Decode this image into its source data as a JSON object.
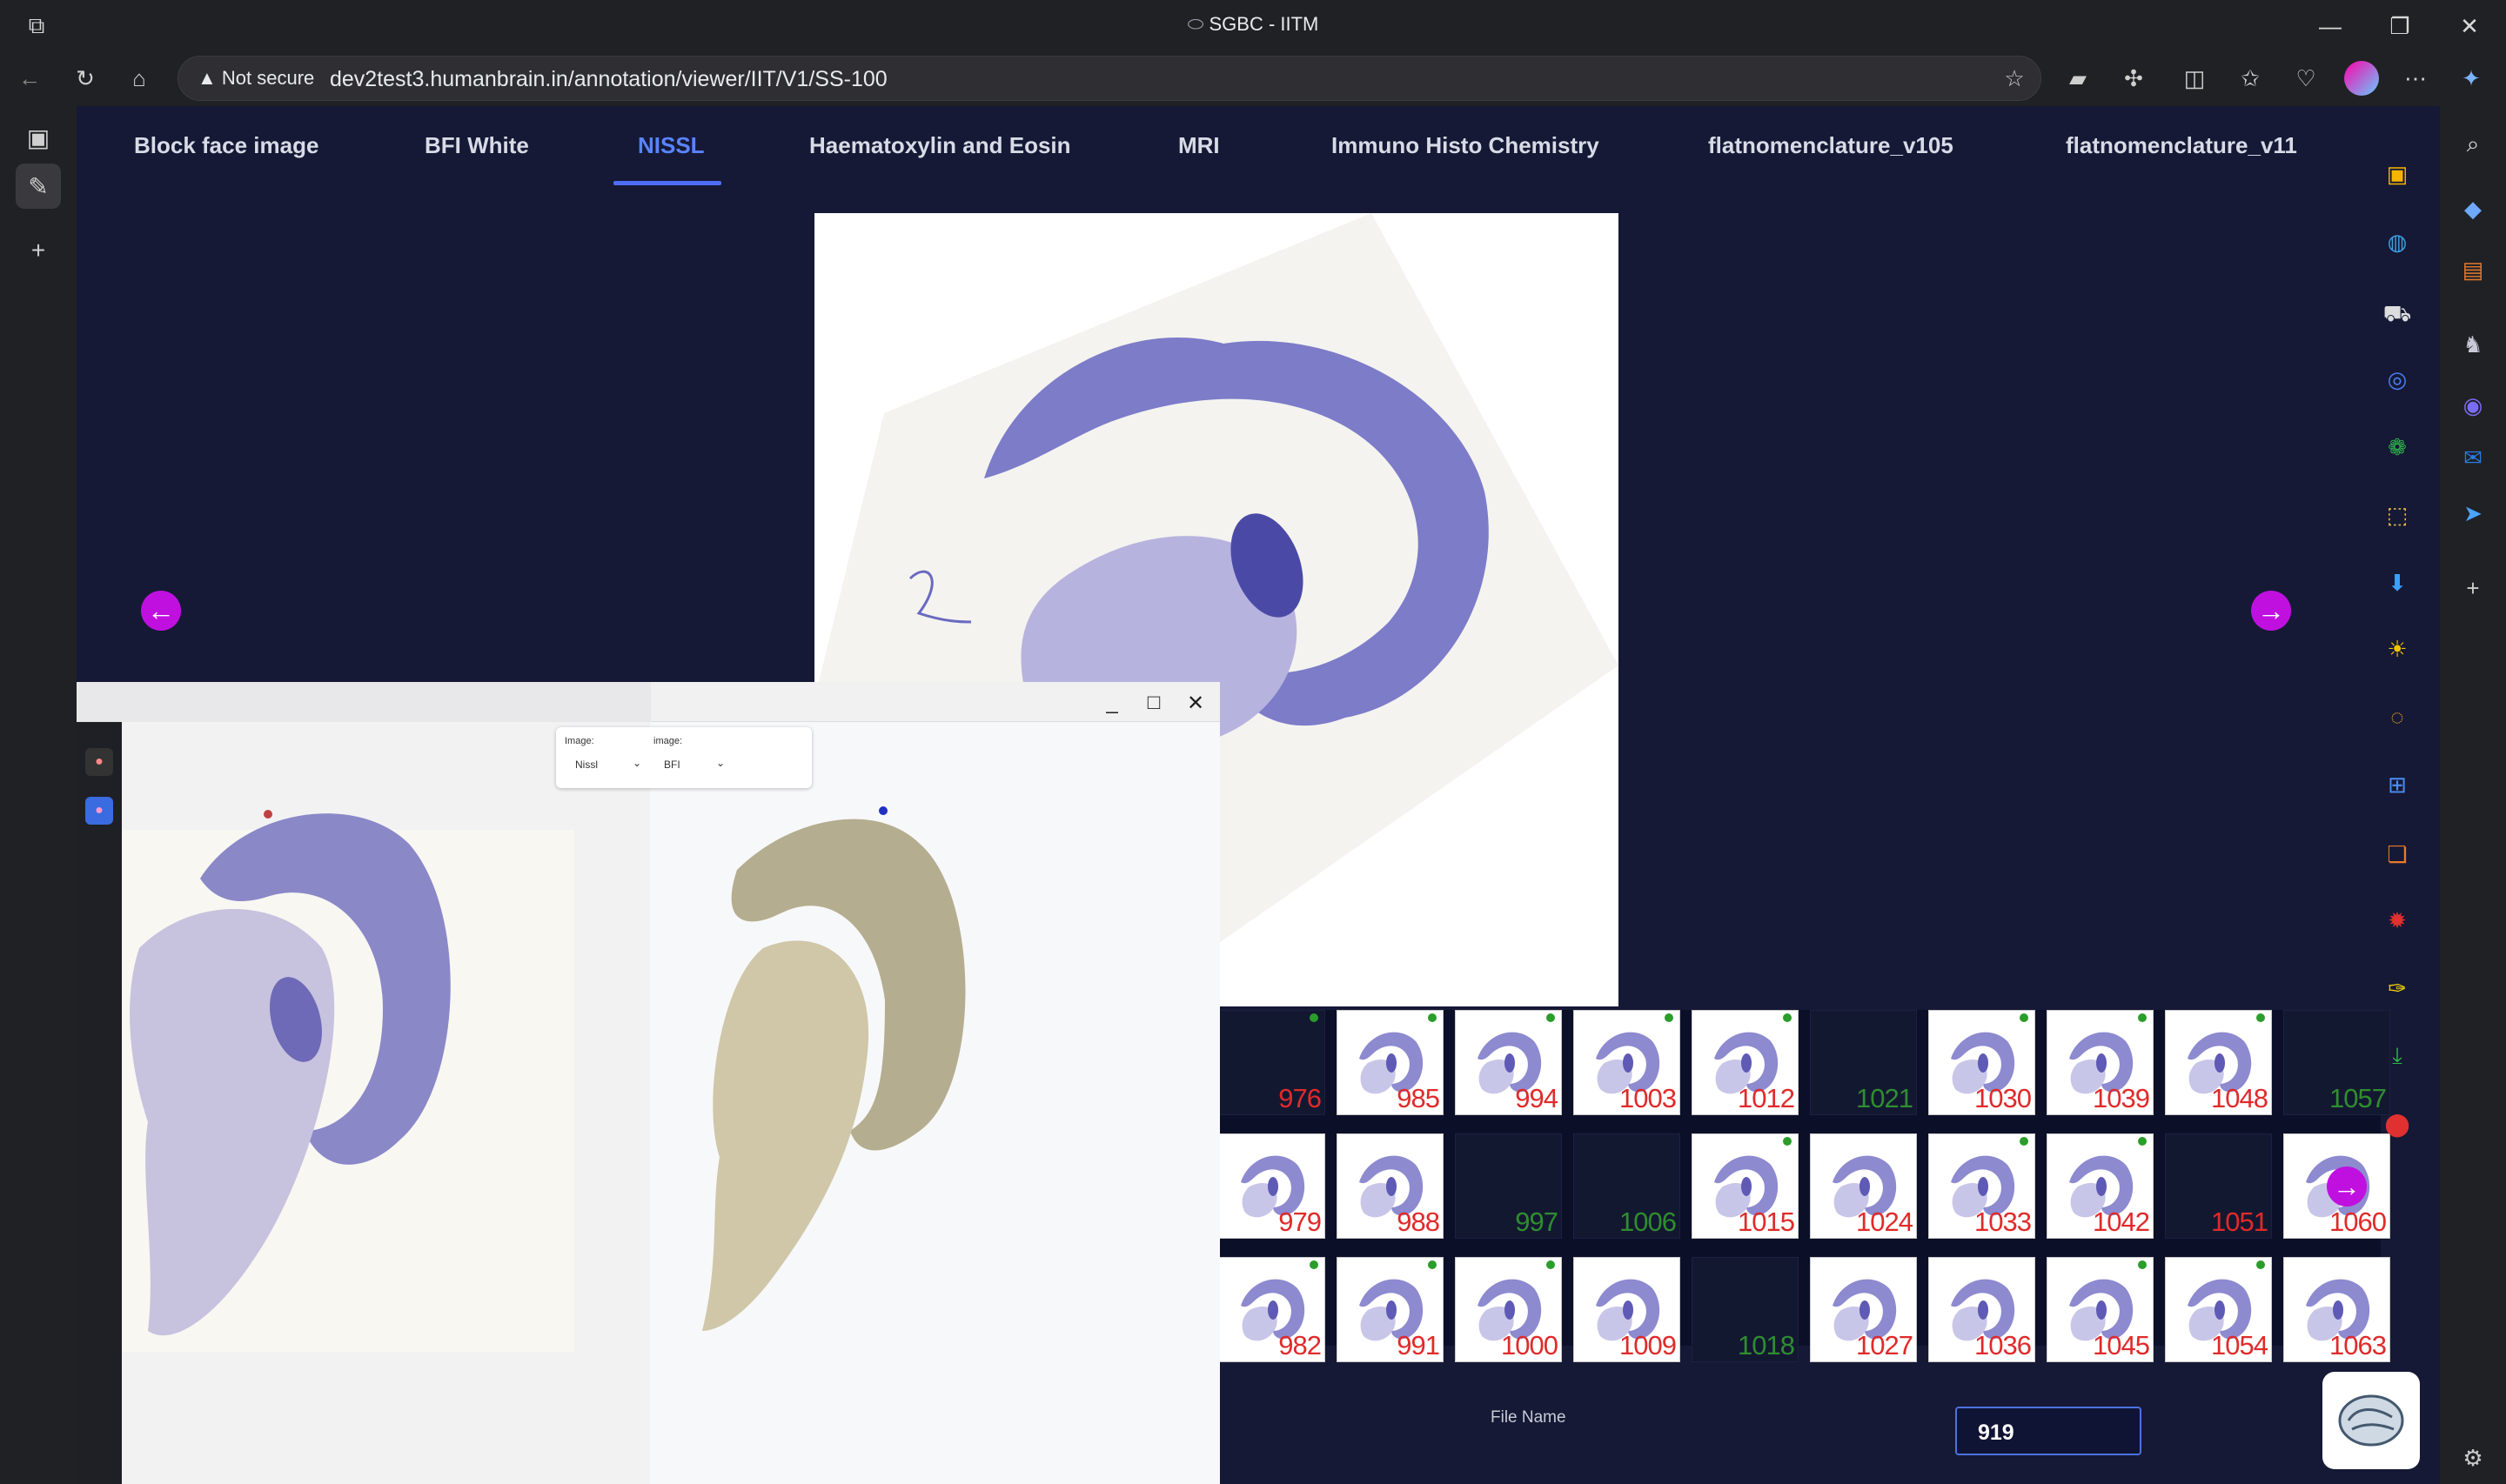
{
  "browser": {
    "window_title": "SGBC - IITM",
    "security_label": "Not secure",
    "url": "dev2test3.humanbrain.in/annotation/viewer/IIT/V1/SS-100"
  },
  "tabs": [
    {
      "label": "Block face image"
    },
    {
      "label": "BFI White"
    },
    {
      "label": "NISSL",
      "active": true
    },
    {
      "label": "Haematoxylin and Eosin"
    },
    {
      "label": "MRI"
    },
    {
      "label": "Immuno Histo Chemistry"
    },
    {
      "label": "flatnomenclature_v105"
    },
    {
      "label": "flatnomenclature_v11"
    }
  ],
  "nav": {
    "prev_icon": "arrow-left-icon",
    "next_icon": "arrow-right-icon"
  },
  "thumbnails": {
    "rows": [
      [
        {
          "n": "976",
          "img": false,
          "dot": true
        },
        {
          "n": "985",
          "img": true,
          "dot": true
        },
        {
          "n": "994",
          "img": true,
          "dot": true
        },
        {
          "n": "1003",
          "img": true,
          "dot": true
        },
        {
          "n": "1012",
          "img": true,
          "dot": true
        },
        {
          "n": "1021",
          "img": false,
          "dot": false
        },
        {
          "n": "1030",
          "img": true,
          "dot": true
        },
        {
          "n": "1039",
          "img": true,
          "dot": true
        },
        {
          "n": "1048",
          "img": true,
          "dot": true
        },
        {
          "n": "1057",
          "img": false,
          "dot": false
        }
      ],
      [
        {
          "n": "979",
          "img": true,
          "dot": false
        },
        {
          "n": "988",
          "img": true,
          "dot": false
        },
        {
          "n": "997",
          "img": false,
          "dot": false
        },
        {
          "n": "1006",
          "img": false,
          "dot": false
        },
        {
          "n": "1015",
          "img": true,
          "dot": true
        },
        {
          "n": "1024",
          "img": true,
          "dot": false
        },
        {
          "n": "1033",
          "img": true,
          "dot": true
        },
        {
          "n": "1042",
          "img": true,
          "dot": true
        },
        {
          "n": "1051",
          "img": false,
          "dot": false,
          "red": true
        },
        {
          "n": "1060",
          "img": true,
          "dot": false
        }
      ],
      [
        {
          "n": "982",
          "img": true,
          "dot": true
        },
        {
          "n": "991",
          "img": true,
          "dot": true
        },
        {
          "n": "1000",
          "img": true,
          "dot": true
        },
        {
          "n": "1009",
          "img": true,
          "dot": false
        },
        {
          "n": "1018",
          "img": false,
          "dot": false
        },
        {
          "n": "1027",
          "img": true,
          "dot": false
        },
        {
          "n": "1036",
          "img": true,
          "dot": false
        },
        {
          "n": "1045",
          "img": true,
          "dot": true
        },
        {
          "n": "1054",
          "img": true,
          "dot": true
        },
        {
          "n": "1063",
          "img": true,
          "dot": false
        }
      ]
    ],
    "colors": {
      "red": "#e02a2a",
      "green": "#2f8d2f",
      "dot": "#2a9d2a"
    }
  },
  "footer": {
    "file_name_label": "File Name",
    "file_name_value": "919"
  },
  "popup": {
    "left_select": {
      "label": "Image:",
      "value": "Nissl"
    },
    "right_select": {
      "label": "image:",
      "value": "BFI"
    }
  },
  "colors": {
    "page_bg": "#151935",
    "accent": "#4f6cf5",
    "nav_arrow": "#c010e0",
    "nissl": "#6f6fc4",
    "bfi": "#b5ad8f"
  }
}
